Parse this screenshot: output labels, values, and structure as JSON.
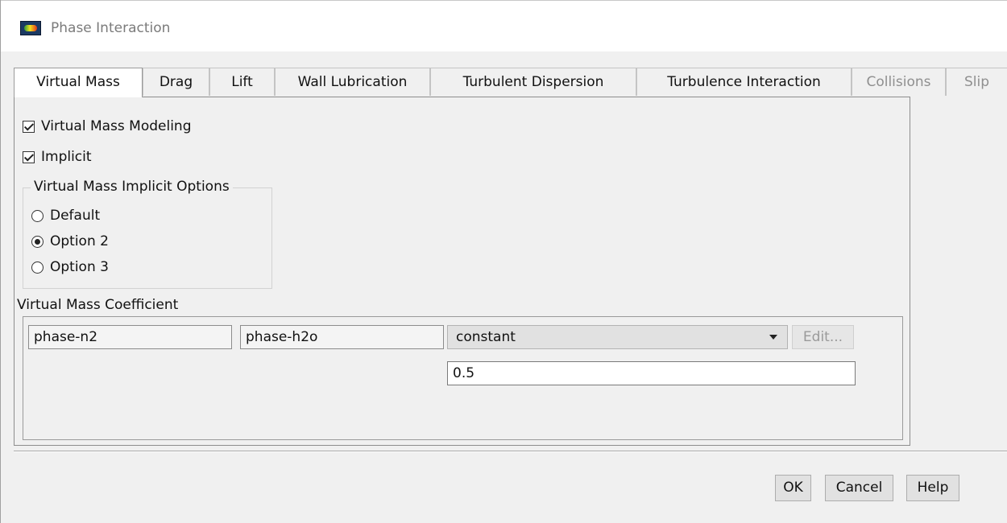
{
  "window": {
    "title": "Phase Interaction"
  },
  "tabs": [
    {
      "label": "Virtual Mass",
      "state": "active"
    },
    {
      "label": "Drag",
      "state": "enabled"
    },
    {
      "label": "Lift",
      "state": "enabled"
    },
    {
      "label": "Wall Lubrication",
      "state": "enabled"
    },
    {
      "label": "Turbulent Dispersion",
      "state": "enabled"
    },
    {
      "label": "Turbulence Interaction",
      "state": "enabled"
    },
    {
      "label": "Collisions",
      "state": "disabled"
    },
    {
      "label": "Slip",
      "state": "disabled"
    }
  ],
  "virtual_mass": {
    "modeling_label": "Virtual Mass Modeling",
    "modeling_checked": true,
    "implicit_label": "Implicit",
    "implicit_checked": true,
    "implicit_options": {
      "legend": "Virtual Mass Implicit Options",
      "selected": "Option 2",
      "options": [
        "Default",
        "Option 2",
        "Option 3"
      ]
    },
    "coefficient": {
      "label": "Virtual Mass Coefficient",
      "phase_1": "phase-n2",
      "phase_2": "phase-h2o",
      "method": "constant",
      "edit_label": "Edit...",
      "value": "0.5"
    }
  },
  "footer": {
    "ok_label": "OK",
    "cancel_label": "Cancel",
    "help_label": "Help"
  },
  "colors": {
    "dialog_background": "#f0f0f0",
    "title_text": "#7b7b7b",
    "disabled_text": "#8f8f8f"
  },
  "icons": {
    "app": "fluent-app-icon",
    "dropdown": "caret-down-icon"
  }
}
